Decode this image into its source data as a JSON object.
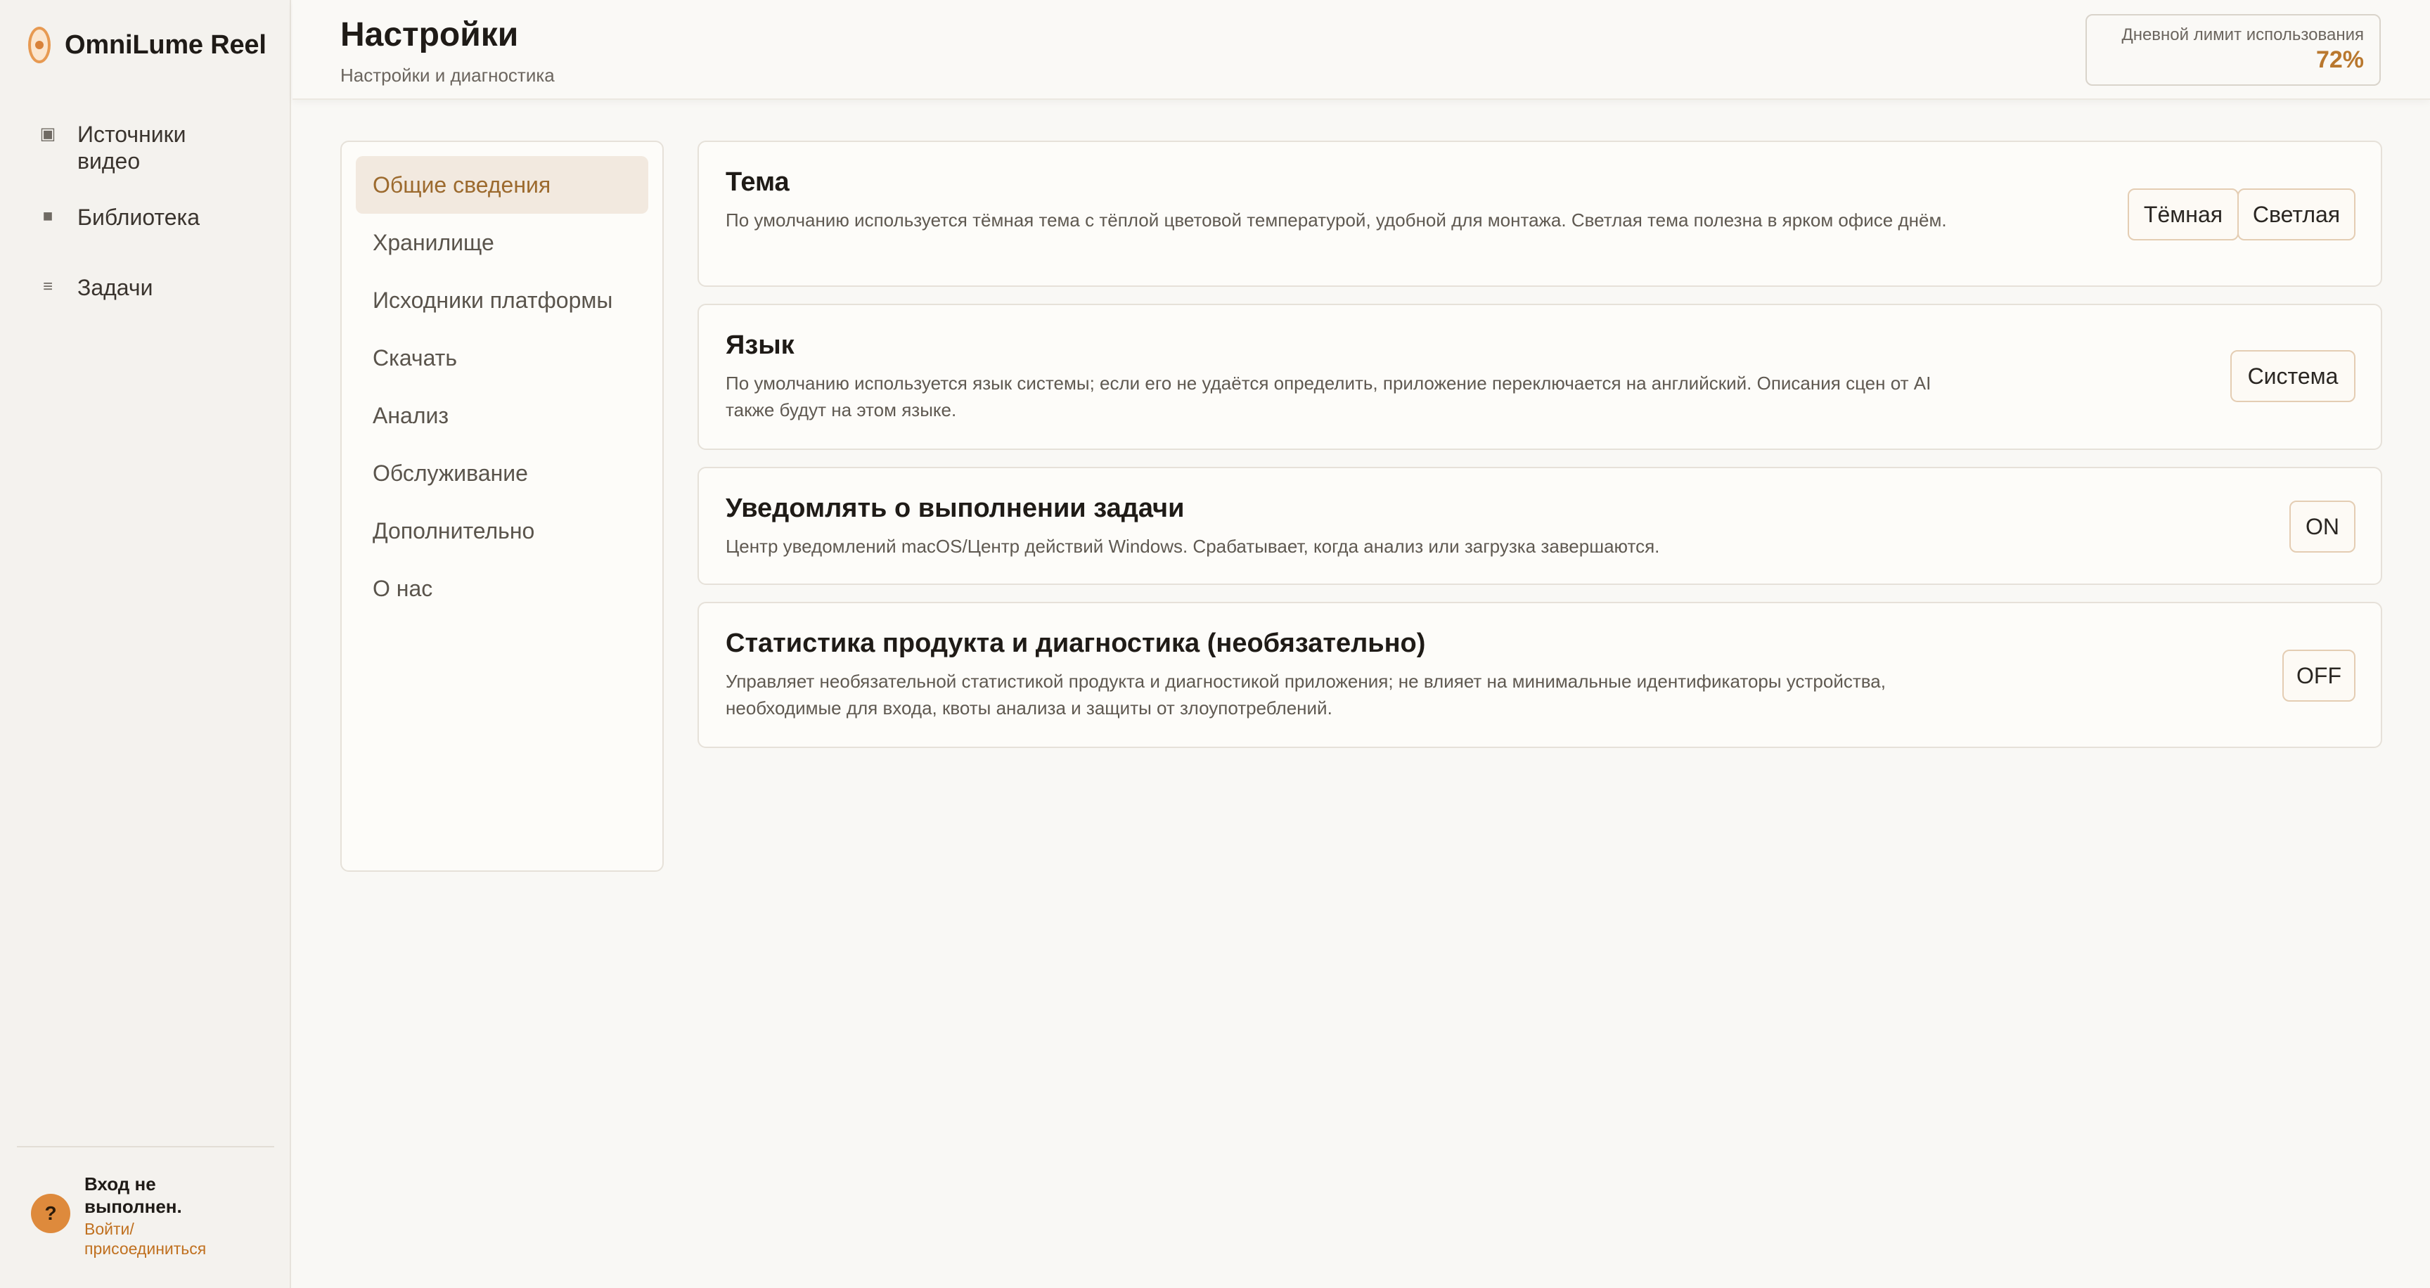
{
  "app": {
    "name": "OmniLume Reel"
  },
  "sidebar": {
    "items": [
      {
        "icon": "video-source-icon",
        "label": "Источники видео"
      },
      {
        "icon": "library-icon",
        "label": "Библиотека"
      },
      {
        "icon": "tasks-icon",
        "label": "Задачи"
      }
    ],
    "user": {
      "avatar": "?",
      "status": "Вход не выполнен.",
      "login_link": "Войти/ присоединиться"
    }
  },
  "header": {
    "title": "Настройки",
    "subtitle": "Настройки и диагностика",
    "usage_limit": {
      "label": "Дневной лимит использования",
      "value": "72%"
    }
  },
  "settings_nav": {
    "items": [
      {
        "label": "Общие сведения",
        "active": true
      },
      {
        "label": "Хранилище"
      },
      {
        "label": "Исходники платформы"
      },
      {
        "label": "Скачать"
      },
      {
        "label": "Анализ"
      },
      {
        "label": "Обслуживание"
      },
      {
        "label": "Дополнительно"
      },
      {
        "label": "О нас"
      }
    ]
  },
  "settings": {
    "theme": {
      "title": "Тема",
      "description": "По умолчанию используется тёмная тема с тёплой цветовой температурой, удобной для монтажа. Светлая тема полезна в ярком офисе днём.",
      "options": [
        "Тёмная",
        "Светлая"
      ]
    },
    "language": {
      "title": "Язык",
      "description": "По умолчанию используется язык системы; если его не удаётся определить, приложение переключается на английский. Описания сцен от AI также будут на этом языке.",
      "value": "Система"
    },
    "notify": {
      "title": "Уведомлять о выполнении задачи",
      "description": "Центр уведомлений macOS/Центр действий Windows. Срабатывает, когда анализ или загрузка завершаются.",
      "toggle": "ON"
    },
    "telemetry": {
      "title": "Статистика продукта и диагностика (необязательно)",
      "description": "Управляет необязательной статистикой продукта и диагностикой приложения; не влияет на минимальные идентификаторы устройства, необходимые для входа, квоты анализа и защиты от злоупотреблений.",
      "toggle": "OFF"
    }
  },
  "colors": {
    "accent": "#b9782e",
    "accent_orange": "#de8a3c",
    "active_nav_bg": "#f2e9df",
    "background": "#f9f8f5"
  }
}
